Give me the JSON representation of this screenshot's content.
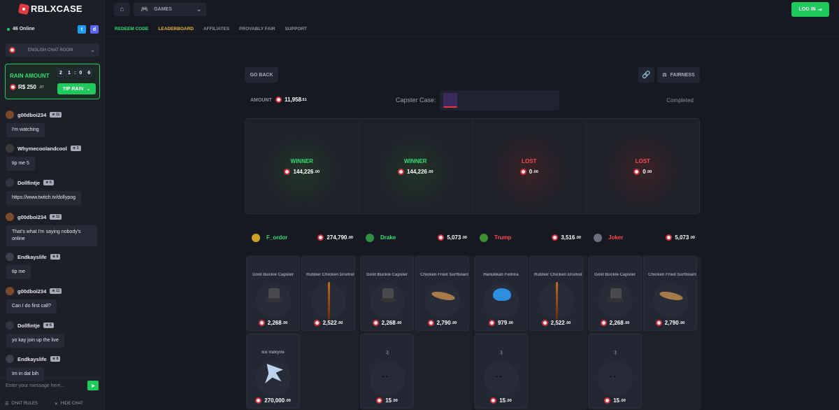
{
  "brand": {
    "name": "RBLXCASE"
  },
  "sidebar": {
    "online": "46 Online",
    "chat_room": "ENGLISH CHAT ROOM",
    "rain": {
      "title": "RAIN AMOUNT",
      "amount": "R$ 250",
      "amount_suffix": ".97",
      "timer": [
        "2",
        "1",
        "0",
        "6"
      ],
      "tip_label": "TIP RAIN"
    },
    "messages": [
      {
        "user": "g00dboi234",
        "level": "11",
        "text": "I'm watching",
        "avatar_color": "#7a4a2a"
      },
      {
        "user": "Whymecoolandcool",
        "level": "3",
        "text": "tip me 5",
        "avatar_color": "#3a3a3a"
      },
      {
        "user": "Dollfintje",
        "level": "6",
        "text": "https://www.twitch.tv/dollypog",
        "avatar_color": "#2f3542"
      },
      {
        "user": "g00dboi234",
        "level": "11",
        "text": "That's what I'm saying nobody's online",
        "avatar_color": "#7a4a2a"
      },
      {
        "user": "Endkayslife",
        "level": "8",
        "text": "tip me",
        "avatar_color": "#3b3f4d"
      },
      {
        "user": "g00dboi234",
        "level": "11",
        "text": "Can I do first call?",
        "avatar_color": "#7a4a2a"
      },
      {
        "user": "Dollfintje",
        "level": "6",
        "text": "yo kay join up the live",
        "avatar_color": "#2f3542"
      },
      {
        "user": "Endkayslife",
        "level": "8",
        "text": "Im in dat bih",
        "avatar_color": "#3b3f4d"
      }
    ],
    "input_placeholder": "Enter your message here...",
    "chat_rules": "CHAT RULES",
    "hide_chat": "HIDE CHAT"
  },
  "topbar": {
    "games": "GAMES",
    "nav": [
      "REDEEM CODE",
      "LEADERBOARD",
      "AFFILIATES",
      "PROVABLY FAIR",
      "SUPPORT"
    ],
    "login": "LOG IN"
  },
  "battle": {
    "go_back": "GO BACK",
    "fairness": "FAIRNESS",
    "amount_label": "AMOUNT",
    "amount_value": "11,958",
    "amount_cents": ".51",
    "case_label": "Capster Case:",
    "status": "Completed",
    "results": [
      {
        "status": "WINNER",
        "value": "144,226",
        "cents": ".00",
        "outcome": "win"
      },
      {
        "status": "WINNER",
        "value": "144,226",
        "cents": ".00",
        "outcome": "win"
      },
      {
        "status": "LOST",
        "value": "0",
        "cents": ".00",
        "outcome": "lose"
      },
      {
        "status": "LOST",
        "value": "0",
        "cents": ".00",
        "outcome": "lose"
      }
    ],
    "players": [
      {
        "name": "F_ordor",
        "value": "274,790",
        "cents": ".00",
        "color": "#2fe06f"
      },
      {
        "name": "Drake",
        "value": "5,073",
        "cents": ".00",
        "color": "#2fe06f"
      },
      {
        "name": "Trump",
        "value": "3,516",
        "cents": ".00",
        "color": "#ff4a4a"
      },
      {
        "name": "Joker",
        "value": "5,073",
        "cents": ".00",
        "color": "#ff4a4a"
      }
    ],
    "items": [
      [
        {
          "name": "Gold Buckle Capster",
          "value": "2,268",
          "cents": ".00",
          "icon": "hat"
        },
        {
          "name": "Rubber Chicken Drumstick",
          "value": "2,522",
          "cents": ".00",
          "icon": "stick"
        },
        {
          "name": "Ice Valkyrie",
          "value": "270,000",
          "cents": ".00",
          "icon": "wing"
        }
      ],
      [
        {
          "name": "Gold Buckle Capster",
          "value": "2,268",
          "cents": ".00",
          "icon": "hat"
        },
        {
          "name": "Chicken Fried Surfboard",
          "value": "2,790",
          "cents": ".00",
          "icon": "drum"
        },
        {
          "name": ":]",
          "value": "15",
          "cents": ".00",
          "icon": "face"
        }
      ],
      [
        {
          "name": "Hanukkah Fedora",
          "value": "979",
          "cents": ".00",
          "icon": "fedora"
        },
        {
          "name": "Rubber Chicken Drumstick",
          "value": "2,522",
          "cents": ".00",
          "icon": "stick"
        },
        {
          "name": ":]",
          "value": "15",
          "cents": ".00",
          "icon": "face"
        }
      ],
      [
        {
          "name": "Gold Buckle Capster",
          "value": "2,268",
          "cents": ".00",
          "icon": "hat"
        },
        {
          "name": "Chicken Fried Surfboard",
          "value": "2,790",
          "cents": ".00",
          "icon": "drum"
        },
        {
          "name": ":]",
          "value": "15",
          "cents": ".00",
          "icon": "face"
        }
      ]
    ]
  }
}
